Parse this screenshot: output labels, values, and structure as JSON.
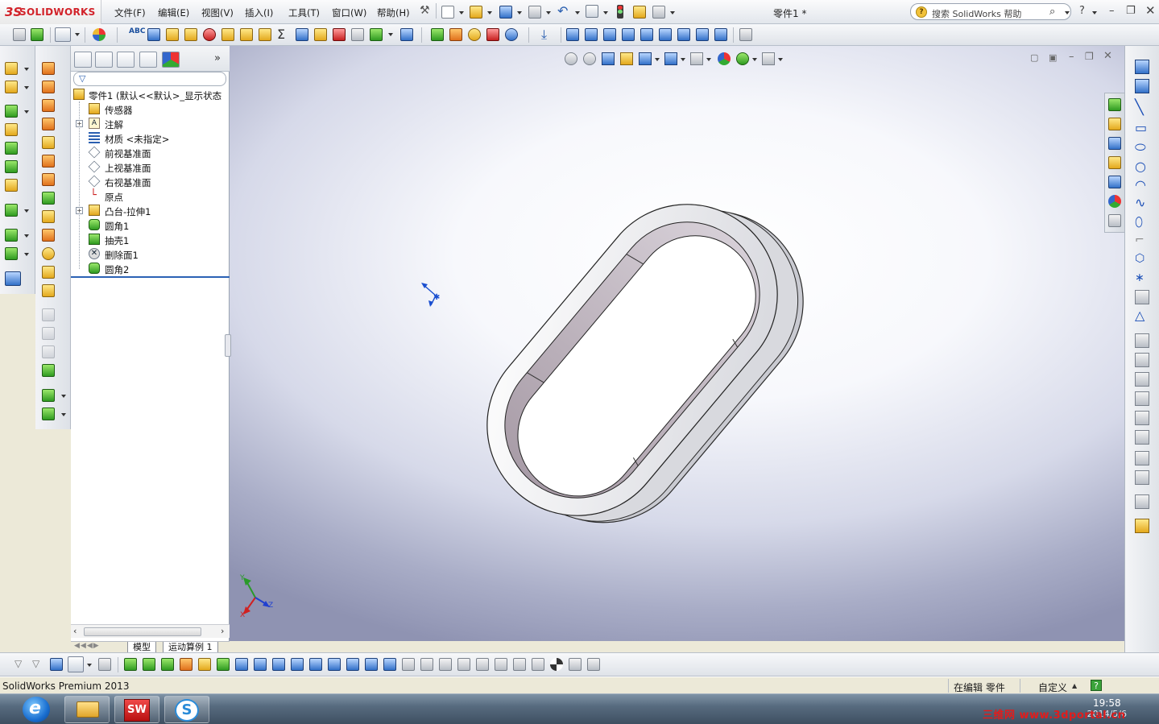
{
  "app": {
    "brand": "SOLIDWORKS",
    "brand_mark": "3S",
    "document_title": "零件1 *",
    "edition": "SolidWorks Premium 2013"
  },
  "menu": [
    {
      "label": "文件(F)"
    },
    {
      "label": "编辑(E)"
    },
    {
      "label": "视图(V)"
    },
    {
      "label": "插入(I)"
    },
    {
      "label": "工具(T)"
    },
    {
      "label": "窗口(W)"
    },
    {
      "label": "帮助(H)"
    }
  ],
  "search": {
    "placeholder": "搜索 SolidWorks 帮助"
  },
  "help_button": {
    "label": "?"
  },
  "feature_tree": {
    "root": "零件1  (默认<<默认>_显示状态",
    "items": [
      {
        "label": "传感器",
        "icon": "sensor-icon",
        "expandable": false
      },
      {
        "label": "注解",
        "icon": "annotation-icon",
        "expandable": true,
        "glyph": "A"
      },
      {
        "label": "材质 <未指定>",
        "icon": "material-icon",
        "expandable": false
      },
      {
        "label": "前视基准面",
        "icon": "plane-icon",
        "expandable": false
      },
      {
        "label": "上视基准面",
        "icon": "plane-icon",
        "expandable": false
      },
      {
        "label": "右视基准面",
        "icon": "plane-icon",
        "expandable": false
      },
      {
        "label": "原点",
        "icon": "origin-icon",
        "expandable": false
      },
      {
        "label": "凸台-拉伸1",
        "icon": "extrude-icon",
        "expandable": true
      },
      {
        "label": "圆角1",
        "icon": "fillet-icon",
        "expandable": false
      },
      {
        "label": "抽壳1",
        "icon": "shell-icon",
        "expandable": false
      },
      {
        "label": "删除面1",
        "icon": "delete-face-icon",
        "expandable": false
      },
      {
        "label": "圆角2",
        "icon": "fillet-icon",
        "expandable": false
      }
    ]
  },
  "bottom_tabs": [
    {
      "label": "模型"
    },
    {
      "label": "运动算例 1"
    }
  ],
  "triad": {
    "x": "X",
    "y": "Y",
    "z": "Z"
  },
  "status": {
    "mode": "在编辑 零件",
    "units": "自定义",
    "help": "?"
  },
  "taskbar": {
    "clock": "19:58",
    "date": "2014/5/6",
    "watermark": "三维网 www.3dportal.cn",
    "app_badge": "SW"
  }
}
